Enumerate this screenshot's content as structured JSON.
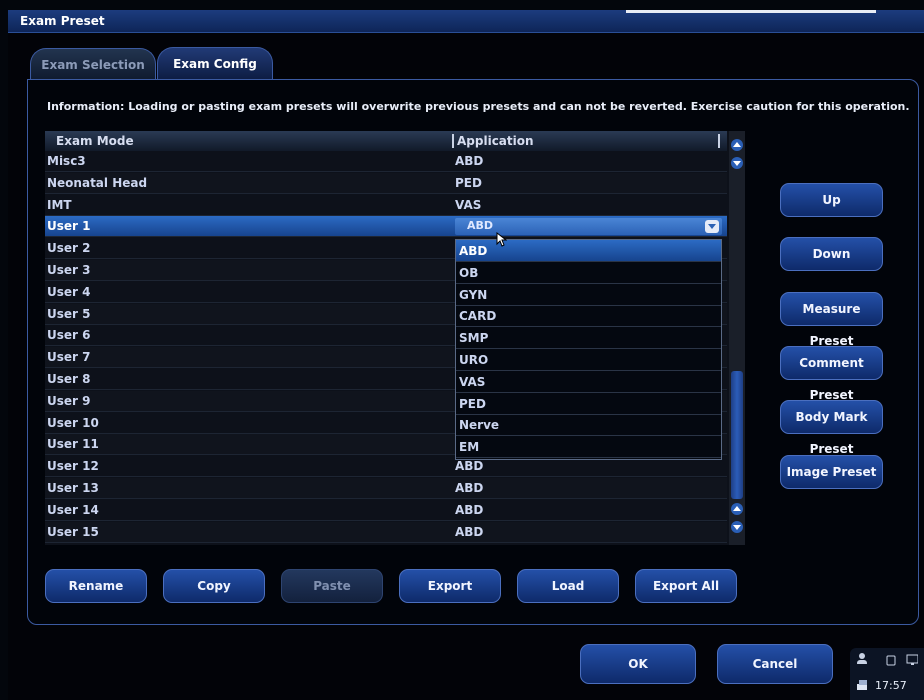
{
  "window": {
    "title": "Exam Preset"
  },
  "tabs": [
    {
      "label": "Exam Selection",
      "active": false
    },
    {
      "label": "Exam Config",
      "active": true
    }
  ],
  "info": "Information: Loading or pasting exam presets will overwrite previous presets and can not be reverted. Exercise caution for this operation.",
  "table": {
    "headers": [
      "Exam Mode",
      "Application"
    ],
    "rows": [
      {
        "mode": "Misc3",
        "app": "ABD"
      },
      {
        "mode": "Neonatal Head",
        "app": "PED"
      },
      {
        "mode": "IMT",
        "app": "VAS"
      },
      {
        "mode": "User 1",
        "app": "ABD",
        "selected": true
      },
      {
        "mode": "User 2",
        "app": ""
      },
      {
        "mode": "User 3",
        "app": ""
      },
      {
        "mode": "User 4",
        "app": ""
      },
      {
        "mode": "User 5",
        "app": ""
      },
      {
        "mode": "User 6",
        "app": ""
      },
      {
        "mode": "User 7",
        "app": ""
      },
      {
        "mode": "User 8",
        "app": ""
      },
      {
        "mode": "User 9",
        "app": ""
      },
      {
        "mode": "User 10",
        "app": ""
      },
      {
        "mode": "User 11",
        "app": ""
      },
      {
        "mode": "User 12",
        "app": "ABD"
      },
      {
        "mode": "User 13",
        "app": "ABD"
      },
      {
        "mode": "User 14",
        "app": "ABD"
      },
      {
        "mode": "User 15",
        "app": "ABD"
      }
    ]
  },
  "dropdown": {
    "selected": "ABD",
    "options": [
      "ABD",
      "OB",
      "GYN",
      "CARD",
      "SMP",
      "URO",
      "VAS",
      "PED",
      "Nerve",
      "EM"
    ]
  },
  "side_buttons": [
    "Up",
    "Down",
    "Measure Preset",
    "Comment Preset",
    "Body Mark Preset",
    "Image Preset"
  ],
  "bottom_buttons": [
    {
      "label": "Rename",
      "enabled": true
    },
    {
      "label": "Copy",
      "enabled": true
    },
    {
      "label": "Paste",
      "enabled": false
    },
    {
      "label": "Export",
      "enabled": true
    },
    {
      "label": "Load",
      "enabled": true
    },
    {
      "label": "Export All",
      "enabled": true
    }
  ],
  "dialog_buttons": {
    "ok": "OK",
    "cancel": "Cancel"
  },
  "tray": {
    "time": "17:57"
  }
}
